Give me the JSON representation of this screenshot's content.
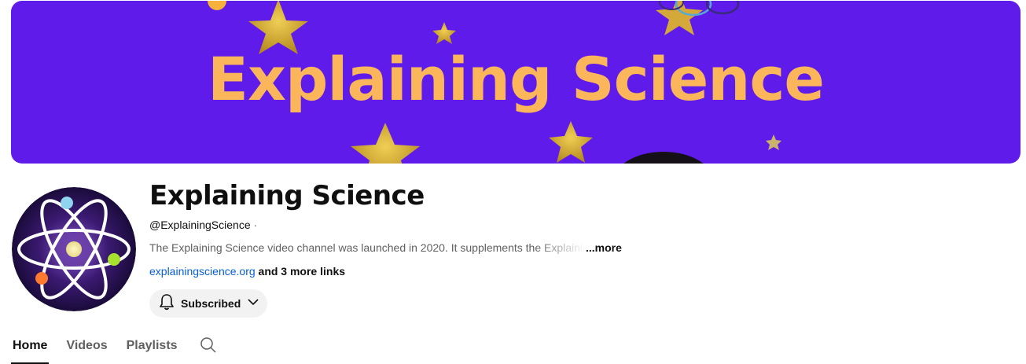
{
  "banner": {
    "title": "Explaining Science",
    "background_color": "#5f1bea",
    "title_color": "#fbb55a"
  },
  "channel": {
    "name": "Explaining Science",
    "handle": "@ExplainingScience",
    "separator": "·",
    "description": "The Explaining Science video channel was launched in 2020. It supplements the Explaining Science blog",
    "more_label": "...more",
    "link_text": "explainingscience.org",
    "more_links_text": "and 3 more links"
  },
  "subscribe": {
    "label": "Subscribed",
    "bell_icon": "bell-icon",
    "chevron_icon": "chevron-down-icon"
  },
  "tabs": [
    {
      "label": "Home",
      "active": true
    },
    {
      "label": "Videos",
      "active": false
    },
    {
      "label": "Playlists",
      "active": false
    }
  ],
  "search_icon": "search-icon",
  "colors": {
    "link": "#065fd4",
    "secondary_text": "#606060",
    "button_bg": "#f2f2f2"
  }
}
